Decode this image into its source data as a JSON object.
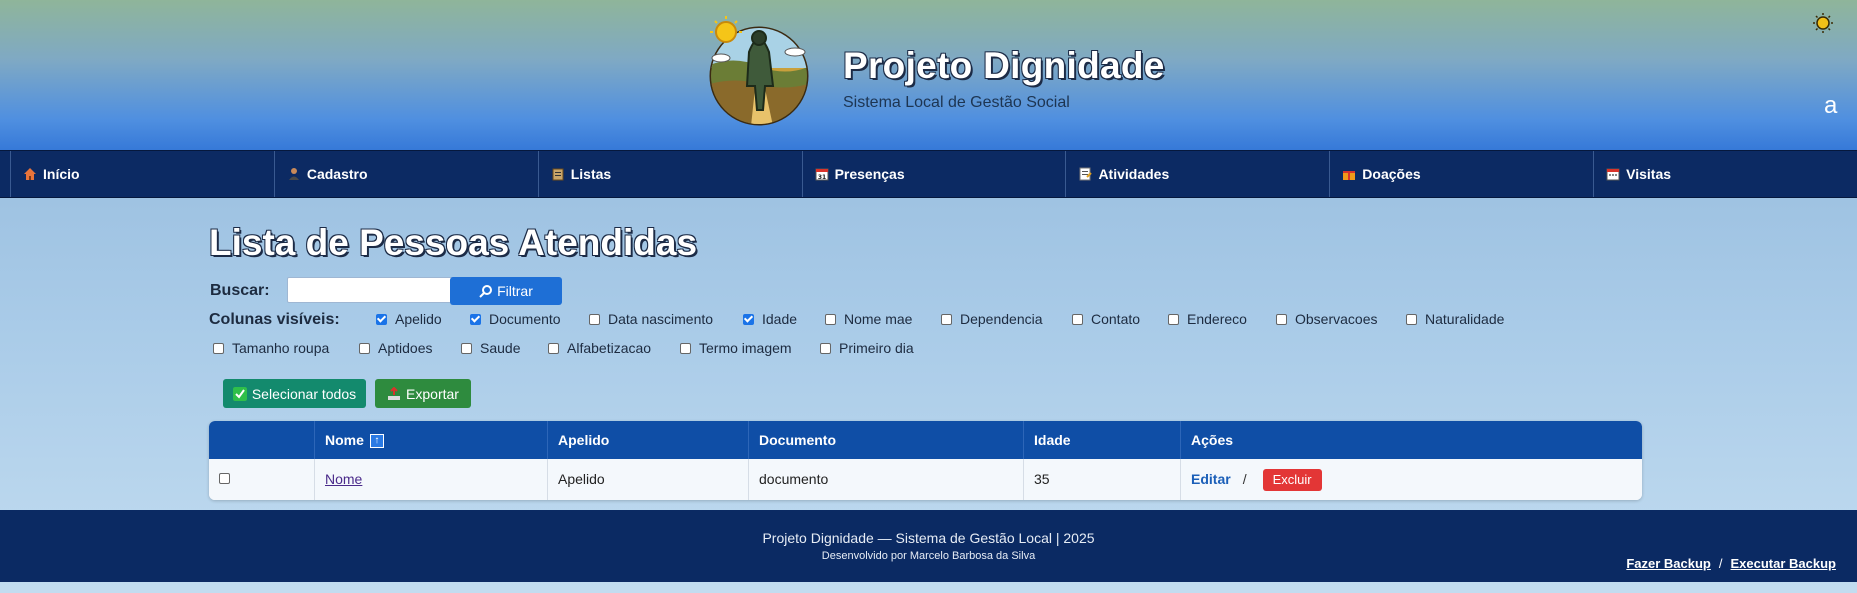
{
  "header": {
    "title": "Projeto Dignidade",
    "subtitle": "Sistema Local de Gestão Social",
    "user_initial": "a"
  },
  "nav": {
    "items": [
      {
        "label": "Início",
        "icon": "house-icon"
      },
      {
        "label": "Cadastro",
        "icon": "person-icon"
      },
      {
        "label": "Listas",
        "icon": "clipboard-icon"
      },
      {
        "label": "Presenças",
        "icon": "calendar-icon"
      },
      {
        "label": "Atividades",
        "icon": "memo-icon"
      },
      {
        "label": "Doações",
        "icon": "gift-icon"
      },
      {
        "label": "Visitas",
        "icon": "calendar-icon"
      }
    ]
  },
  "main": {
    "title": "Lista de Pessoas Atendidas",
    "search_label": "Buscar:",
    "search_value": "",
    "filter_label": "Filtrar",
    "columns_label": "Colunas visíveis:",
    "columns": [
      {
        "label": "Apelido",
        "checked": true
      },
      {
        "label": "Documento",
        "checked": true
      },
      {
        "label": "Data nascimento",
        "checked": false
      },
      {
        "label": "Idade",
        "checked": true
      },
      {
        "label": "Nome mae",
        "checked": false
      },
      {
        "label": "Dependencia",
        "checked": false
      },
      {
        "label": "Contato",
        "checked": false
      },
      {
        "label": "Endereco",
        "checked": false
      },
      {
        "label": "Observacoes",
        "checked": false
      },
      {
        "label": "Naturalidade",
        "checked": false
      },
      {
        "label": "Tamanho roupa",
        "checked": false
      },
      {
        "label": "Aptidoes",
        "checked": false
      },
      {
        "label": "Saude",
        "checked": false
      },
      {
        "label": "Alfabetizacao",
        "checked": false
      },
      {
        "label": "Termo imagem",
        "checked": false
      },
      {
        "label": "Primeiro dia",
        "checked": false
      }
    ],
    "select_all_label": "Selecionar todos",
    "export_label": "Exportar"
  },
  "table": {
    "headers": {
      "nome": "Nome",
      "apelido": "Apelido",
      "documento": "Documento",
      "idade": "Idade",
      "acoes": "Ações"
    },
    "rows": [
      {
        "nome": "Nome",
        "apelido": "Apelido",
        "documento": "documento",
        "idade": "35",
        "edit": "Editar",
        "sep": "/",
        "delete": "Excluir"
      }
    ]
  },
  "footer": {
    "main": "Projeto Dignidade — Sistema de Gestão Local | 2025",
    "sub": "Desenvolvido por Marcelo Barbosa da Silva",
    "backup": "Fazer Backup",
    "slash": "/",
    "run_backup": "Executar Backup"
  },
  "colors": {
    "nav_bg": "#0c2a63",
    "filter_btn": "#1e6fd6",
    "select_btn": "#138a6d",
    "export_btn": "#2e8b3e",
    "table_header": "#0f4ea6",
    "delete_btn": "#e33636"
  }
}
